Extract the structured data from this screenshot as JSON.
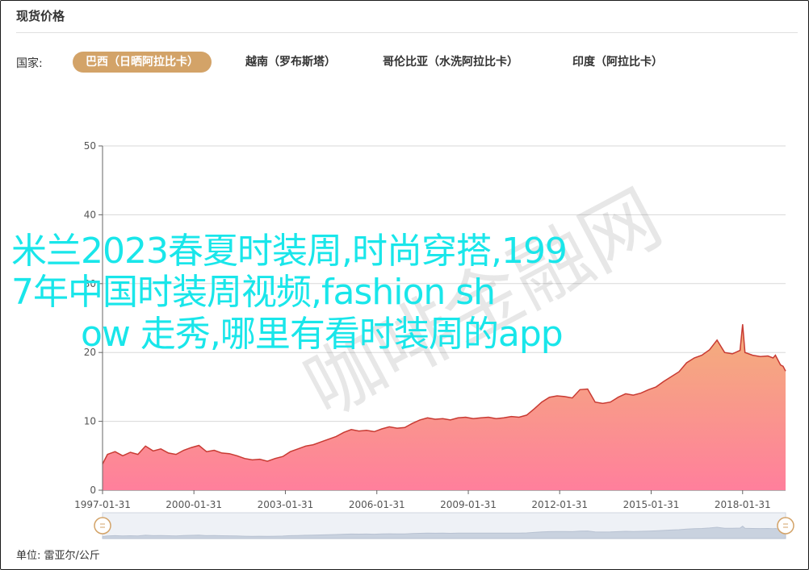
{
  "header": {
    "title": "现货价格"
  },
  "filters": {
    "label": "国家:",
    "tabs": [
      {
        "label": "巴西（日晒阿拉比卡）",
        "active": true
      },
      {
        "label": "越南（罗布斯塔）",
        "active": false
      },
      {
        "label": "哥伦比亚（水洗阿拉比卡）",
        "active": false
      },
      {
        "label": "印度（阿拉比卡）",
        "active": false
      }
    ]
  },
  "overlay": {
    "line1": "米兰2023春夏时装周,时尚穿搭,199",
    "line2": "7年中国时装周视频,fashion sh",
    "line3": "ow 走秀,哪里有看时装周的app"
  },
  "watermark": "咖啡金融网",
  "footer": {
    "unit": "单位:  雷亚尔/公斤"
  },
  "colors": {
    "accent": "#d3a368",
    "line": "#c83a32",
    "area_top": "#f3b07a",
    "area_bottom": "#ff7f9c",
    "overlay": "#19e6ea"
  },
  "chart_data": {
    "type": "area",
    "xlim": [
      "1997-01-31",
      "2019-06-30"
    ],
    "ylim": [
      0,
      50
    ],
    "yticks": [
      0,
      10,
      20,
      30,
      40,
      50
    ],
    "ytick_labels": [
      "0",
      "10",
      "20",
      "30",
      "40",
      "50"
    ],
    "xtick_labels": [
      "1997-01-31",
      "2000-01-31",
      "2003-01-31",
      "2006-01-31",
      "2009-01-31",
      "2012-01-31",
      "2015-01-31",
      "2018-01-31"
    ],
    "grid": true,
    "series": [
      {
        "values": [
          [
            "1997-01-31",
            3.8
          ],
          [
            "1997-03-31",
            5.2
          ],
          [
            "1997-06-30",
            5.6
          ],
          [
            "1997-09-30",
            5.0
          ],
          [
            "1997-12-31",
            5.5
          ],
          [
            "1998-03-31",
            5.2
          ],
          [
            "1998-06-30",
            6.4
          ],
          [
            "1998-09-30",
            5.7
          ],
          [
            "1998-12-31",
            6.0
          ],
          [
            "1999-03-31",
            5.4
          ],
          [
            "1999-06-30",
            5.2
          ],
          [
            "1999-09-30",
            5.8
          ],
          [
            "1999-12-31",
            6.2
          ],
          [
            "2000-03-31",
            6.5
          ],
          [
            "2000-06-30",
            5.6
          ],
          [
            "2000-09-30",
            5.8
          ],
          [
            "2000-12-31",
            5.4
          ],
          [
            "2001-03-31",
            5.3
          ],
          [
            "2001-06-30",
            5.0
          ],
          [
            "2001-09-30",
            4.6
          ],
          [
            "2001-12-31",
            4.4
          ],
          [
            "2002-03-31",
            4.5
          ],
          [
            "2002-06-30",
            4.2
          ],
          [
            "2002-09-30",
            4.6
          ],
          [
            "2002-12-31",
            4.9
          ],
          [
            "2003-03-31",
            5.6
          ],
          [
            "2003-06-30",
            6.0
          ],
          [
            "2003-09-30",
            6.4
          ],
          [
            "2003-12-31",
            6.6
          ],
          [
            "2004-03-31",
            7.0
          ],
          [
            "2004-06-30",
            7.4
          ],
          [
            "2004-09-30",
            7.8
          ],
          [
            "2004-12-31",
            8.4
          ],
          [
            "2005-03-31",
            8.8
          ],
          [
            "2005-06-30",
            8.6
          ],
          [
            "2005-09-30",
            8.7
          ],
          [
            "2005-12-31",
            8.5
          ],
          [
            "2006-03-31",
            8.9
          ],
          [
            "2006-06-30",
            9.2
          ],
          [
            "2006-09-30",
            9.0
          ],
          [
            "2006-12-31",
            9.1
          ],
          [
            "2007-03-31",
            9.7
          ],
          [
            "2007-06-30",
            10.2
          ],
          [
            "2007-09-30",
            10.5
          ],
          [
            "2007-12-31",
            10.3
          ],
          [
            "2008-03-31",
            10.4
          ],
          [
            "2008-06-30",
            10.2
          ],
          [
            "2008-09-30",
            10.5
          ],
          [
            "2008-12-31",
            10.6
          ],
          [
            "2009-03-31",
            10.4
          ],
          [
            "2009-06-30",
            10.5
          ],
          [
            "2009-09-30",
            10.6
          ],
          [
            "2009-12-31",
            10.4
          ],
          [
            "2010-03-31",
            10.5
          ],
          [
            "2010-06-30",
            10.7
          ],
          [
            "2010-09-30",
            10.6
          ],
          [
            "2010-12-31",
            10.9
          ],
          [
            "2011-03-31",
            11.8
          ],
          [
            "2011-06-30",
            12.8
          ],
          [
            "2011-09-30",
            13.5
          ],
          [
            "2011-12-31",
            13.7
          ],
          [
            "2012-03-31",
            13.6
          ],
          [
            "2012-06-30",
            13.4
          ],
          [
            "2012-09-30",
            14.6
          ],
          [
            "2012-12-31",
            14.7
          ],
          [
            "2013-03-31",
            12.8
          ],
          [
            "2013-06-30",
            12.6
          ],
          [
            "2013-09-30",
            12.8
          ],
          [
            "2013-12-31",
            13.5
          ],
          [
            "2014-03-31",
            14.0
          ],
          [
            "2014-06-30",
            13.8
          ],
          [
            "2014-09-30",
            14.1
          ],
          [
            "2014-12-31",
            14.6
          ],
          [
            "2015-03-31",
            15.0
          ],
          [
            "2015-06-30",
            15.8
          ],
          [
            "2015-09-30",
            16.5
          ],
          [
            "2015-12-31",
            17.2
          ],
          [
            "2016-03-31",
            18.5
          ],
          [
            "2016-06-30",
            19.2
          ],
          [
            "2016-09-30",
            19.6
          ],
          [
            "2016-12-31",
            20.4
          ],
          [
            "2017-03-31",
            21.8
          ],
          [
            "2017-06-30",
            20.0
          ],
          [
            "2017-09-30",
            19.8
          ],
          [
            "2017-12-31",
            20.3
          ],
          [
            "2018-01-31",
            24.1
          ],
          [
            "2018-02-28",
            20.0
          ],
          [
            "2018-05-31",
            19.6
          ],
          [
            "2018-08-31",
            19.4
          ],
          [
            "2018-11-30",
            19.5
          ],
          [
            "2019-01-31",
            19.2
          ],
          [
            "2019-02-28",
            19.6
          ],
          [
            "2019-04-30",
            18.2
          ],
          [
            "2019-05-31",
            18.0
          ],
          [
            "2019-06-30",
            17.3
          ]
        ]
      }
    ]
  }
}
